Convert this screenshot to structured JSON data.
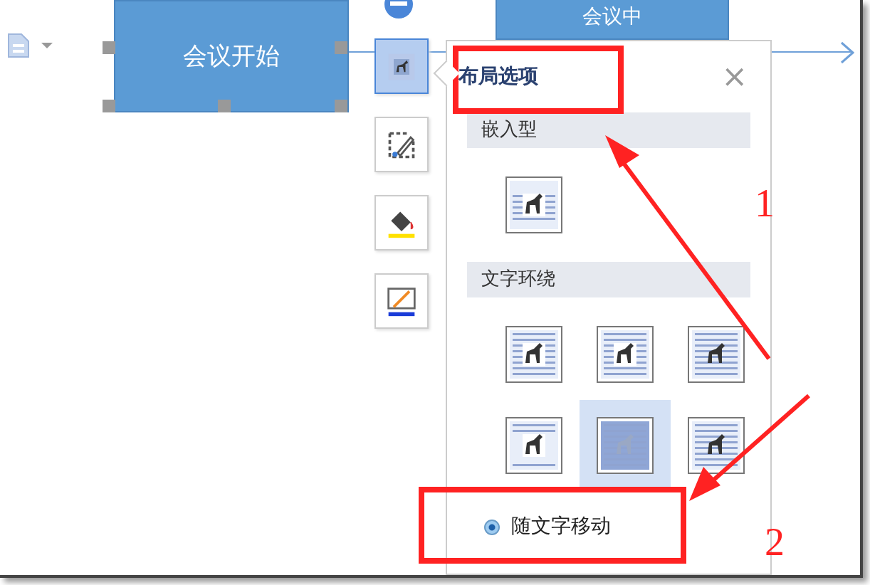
{
  "canvas": {
    "shapes": [
      {
        "label": "会议开始",
        "selected": true
      },
      {
        "label": "会议中"
      }
    ]
  },
  "side_buttons": [
    {
      "kind": "layout",
      "selected": true
    },
    {
      "kind": "style",
      "selected": false
    },
    {
      "kind": "fill",
      "selected": false
    },
    {
      "kind": "outline",
      "selected": false
    }
  ],
  "panel": {
    "title": "布局选项",
    "close": "×",
    "sections": [
      {
        "title": "嵌入型",
        "options": [
          {
            "kind": "inline",
            "selected": false
          }
        ]
      },
      {
        "title": "文字环绕",
        "options": [
          {
            "kind": "square",
            "selected": false
          },
          {
            "kind": "tight",
            "selected": false
          },
          {
            "kind": "through",
            "selected": false
          },
          {
            "kind": "topbottom",
            "selected": false
          },
          {
            "kind": "behind",
            "selected": true
          },
          {
            "kind": "front",
            "selected": false
          }
        ]
      }
    ],
    "radios": [
      {
        "label": "随文字移动",
        "checked": true
      }
    ]
  },
  "annotations": [
    "1",
    "2"
  ]
}
